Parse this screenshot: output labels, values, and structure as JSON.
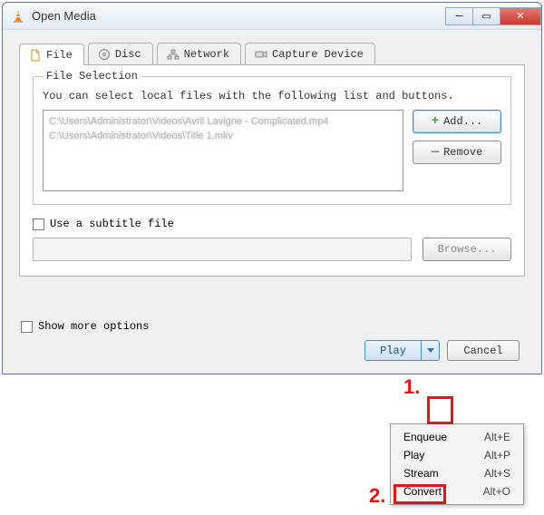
{
  "window": {
    "title": "Open Media"
  },
  "tabs": {
    "file": "File",
    "disc": "Disc",
    "network": "Network",
    "capture": "Capture Device"
  },
  "file_selection": {
    "legend": "File Selection",
    "hint": "You can select local files with the following list and buttons.",
    "files": [
      "C:\\Users\\Administrator\\Videos\\Avril Lavigne - Complicated.mp4",
      "C:\\Users\\Administrator\\Videos\\Title 1.mkv"
    ],
    "add_btn": "Add...",
    "remove_btn": "Remove"
  },
  "subtitle": {
    "checkbox_label": "Use a subtitle file",
    "browse": "Browse..."
  },
  "show_more": "Show more options",
  "footer": {
    "play": "Play",
    "cancel": "Cancel"
  },
  "dropdown_menu": [
    {
      "label": "Enqueue",
      "shortcut": "Alt+E"
    },
    {
      "label": "Play",
      "shortcut": "Alt+P"
    },
    {
      "label": "Stream",
      "shortcut": "Alt+S"
    },
    {
      "label": "Convert",
      "shortcut": "Alt+O"
    }
  ],
  "callouts": {
    "one": "1.",
    "two": "2."
  }
}
